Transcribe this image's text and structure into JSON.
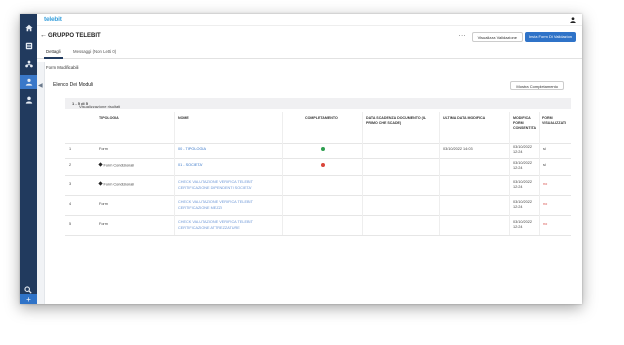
{
  "app": {
    "logo_main": "tele",
    "logo_accent": "bit",
    "page_title": "GRUPPO TELEBIT"
  },
  "header": {
    "more_label": "...",
    "visualizza_button": "Visualizza Validazione",
    "invia_button": "Invia Form Di Validazion"
  },
  "tabs": [
    {
      "label": "Dettagli",
      "active": true
    },
    {
      "label": "Messaggi (Non Letti 0)",
      "active": false
    }
  ],
  "section_label": "Form Modificabili",
  "list": {
    "title": "Elenco Dei Moduli",
    "mostra_button": "Mostra Completamento",
    "visualization_prefix": "Visualizzazione risultati",
    "visualization_range": "1 - 5 di 5"
  },
  "table": {
    "headers": [
      "TIPOLOGIA",
      "NOME",
      "COMPLETAMENTO",
      "DATA SCADENZA DOCUMENTO (IL PRIMO CHE SCADE)",
      "ULTIMA DATA MODIFICA",
      "MODIFICA FORM CONSENTITA",
      "FORM VISUALIZZATI"
    ],
    "rows": [
      {
        "num": "1",
        "tipologia": "Form",
        "conditional": false,
        "nome": [
          "00 - TIPOLOGIA"
        ],
        "status": "green",
        "scadenza": "",
        "ultima": "03/10/2022 14:03",
        "modifica": "03/10/2022 12:24",
        "visualizzati": "si"
      },
      {
        "num": "2",
        "tipologia": "Form Condizionali",
        "conditional": true,
        "nome": [
          "01 - SOCIETA'"
        ],
        "status": "red",
        "scadenza": "",
        "ultima": "",
        "modifica": "03/10/2022 12:24",
        "visualizzati": "si"
      },
      {
        "num": "3",
        "tipologia": "Form Condizionali",
        "conditional": true,
        "nome": [
          "CHECK VALUTAZIONE VERIFICA TELEBIT",
          "CERTIFICAZIONE DIPENDENTI SOCIETA'"
        ],
        "status": "",
        "scadenza": "",
        "ultima": "",
        "modifica": "03/10/2022 12:24",
        "visualizzati": "no"
      },
      {
        "num": "4",
        "tipologia": "Form",
        "conditional": false,
        "nome": [
          "CHECK VALUTAZIONE VERIFICA TELEBIT",
          "CERTIFICAZIONE MEZZI"
        ],
        "status": "",
        "scadenza": "",
        "ultima": "",
        "modifica": "03/10/2022 12:24",
        "visualizzati": "no"
      },
      {
        "num": "5",
        "tipologia": "Form",
        "conditional": false,
        "nome": [
          "CHECK VALUTAZIONE VERIFICA TELEBIT",
          "CERTIFICAZIONE ATTREZZATURE"
        ],
        "status": "",
        "scadenza": "",
        "ultima": "",
        "modifica": "03/10/2022 12:24",
        "visualizzati": "no"
      }
    ]
  },
  "colors": {
    "sidebar": "#213a5e",
    "accent": "#2f73c8",
    "link": "#3a78c9",
    "status_green": "#2e9e4f",
    "status_red": "#d9463a"
  },
  "icons": [
    "home-icon",
    "dashboard-icon",
    "network-icon",
    "user-upload-icon",
    "user-icon",
    "search-icon",
    "plus-icon",
    "collapse-arrow-icon",
    "profile-icon",
    "tag-icon"
  ]
}
